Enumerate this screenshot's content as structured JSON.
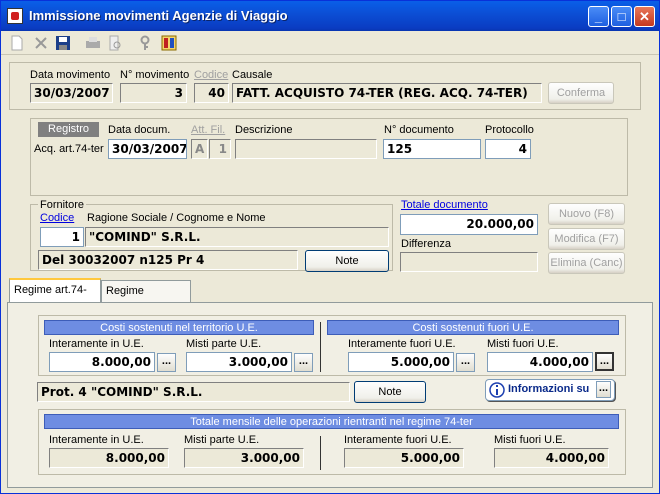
{
  "window": {
    "title": "Immissione movimenti Agenzie di Viaggio"
  },
  "header": {
    "data_movimento_label": "Data movimento",
    "data_movimento": "30/03/2007",
    "n_movimento_label": "N° movimento",
    "n_movimento": "3",
    "codice_label": "Codice",
    "codice": "40",
    "causale_label": "Causale",
    "causale": "FATT. ACQUISTO 74-TER (REG. ACQ. 74-TER)",
    "conferma": "Conferma"
  },
  "registro": {
    "tab_label": "Registro",
    "registro_value": "Acq. art.74-ter",
    "data_docum_label": "Data docum.",
    "data_docum": "30/03/2007",
    "att_fil_label": "Att. Fil.",
    "att": "A",
    "fil": "1",
    "descrizione_label": "Descrizione",
    "descrizione": "",
    "n_documento_label": "N° documento",
    "n_documento": "125",
    "protocollo_label": "Protocollo",
    "protocollo": "4"
  },
  "fornitore": {
    "group_label": "Fornitore",
    "codice_label": "Codice",
    "ragione_label": "Ragione Sociale / Cognome e Nome",
    "codice": "1",
    "ragione": "\"COMIND\" S.R.L.",
    "note_text": "Del 30032007 n125 Pr      4",
    "note_btn": "Note"
  },
  "totale": {
    "label": "Totale documento",
    "value": "20.000,00",
    "differenza_label": "Differenza",
    "differenza": ""
  },
  "actions": {
    "nuovo": "Nuovo (F8)",
    "modifica": "Modifica (F7)",
    "elimina": "Elimina (Canc)"
  },
  "tabs": [
    {
      "label": "Regime art.74-ter"
    },
    {
      "label": "Regime Ordinario"
    }
  ],
  "regime": {
    "costi_ue_hdr": "Costi sostenuti nel territorio U.E.",
    "costi_extra_hdr": "Costi sostenuti fuori U.E.",
    "interamente_ue_label": "Interamente in U.E.",
    "interamente_ue": "8.000,00",
    "misti_parte_label": "Misti parte U.E.",
    "misti_parte": "3.000,00",
    "interamente_fuori_label": "Interamente fuori U.E.",
    "interamente_fuori": "5.000,00",
    "misti_fuori_label": "Misti fuori U.E.",
    "misti_fuori": "4.000,00",
    "prot_text": "Prot.      4 \"COMIND\" S.R.L.",
    "note_btn": "Note",
    "info_btn": "Informazioni su",
    "totale_hdr": "Totale  mensile delle operazioni rientranti nel regime 74-ter",
    "tot_interamente_ue_label": "Interamente in U.E.",
    "tot_interamente_ue": "8.000,00",
    "tot_misti_parte_label": "Misti parte U.E.",
    "tot_misti_parte": "3.000,00",
    "tot_interamente_fuori_label": "Interamente fuori U.E.",
    "tot_interamente_fuori": "5.000,00",
    "tot_misti_fuori_label": "Misti fuori U.E.",
    "tot_misti_fuori": "4.000,00",
    "ellipsis": "..."
  }
}
